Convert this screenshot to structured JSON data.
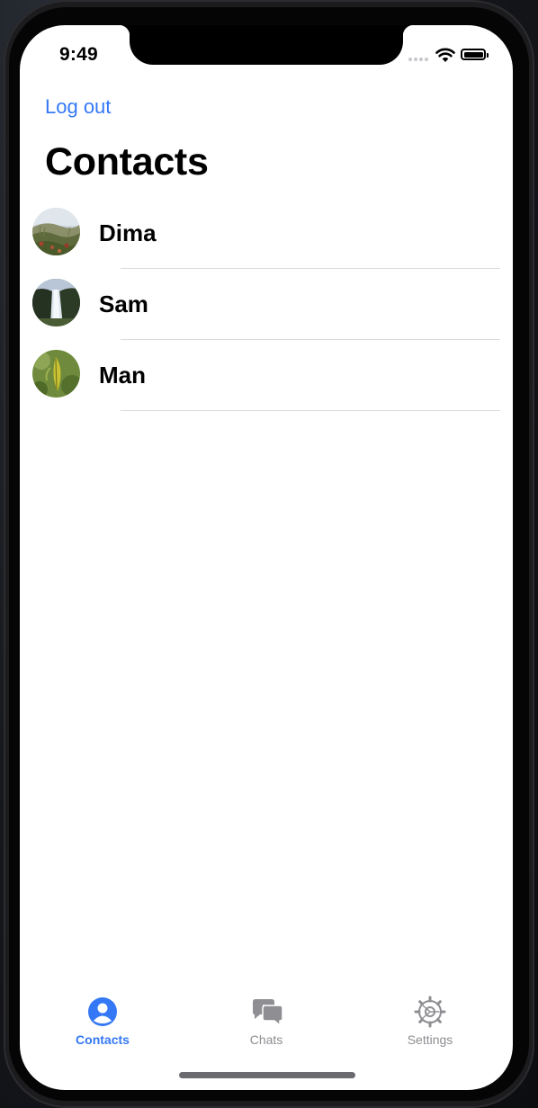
{
  "status_bar": {
    "time": "9:49"
  },
  "nav": {
    "logout_label": "Log out",
    "title": "Contacts"
  },
  "contacts": [
    {
      "name": "Dima",
      "avatar": "meadow-photo"
    },
    {
      "name": "Sam",
      "avatar": "waterfall-photo"
    },
    {
      "name": "Man",
      "avatar": "leaf-photo"
    }
  ],
  "tab_bar": {
    "tabs": [
      {
        "label": "Contacts",
        "icon": "person-circle-icon",
        "active": true
      },
      {
        "label": "Chats",
        "icon": "chat-bubbles-icon",
        "active": false
      },
      {
        "label": "Settings",
        "icon": "gear-icon",
        "active": false
      }
    ]
  },
  "colors": {
    "accent": "#3478f6",
    "inactive": "#8e8e93",
    "separator": "#dcdcdf"
  }
}
